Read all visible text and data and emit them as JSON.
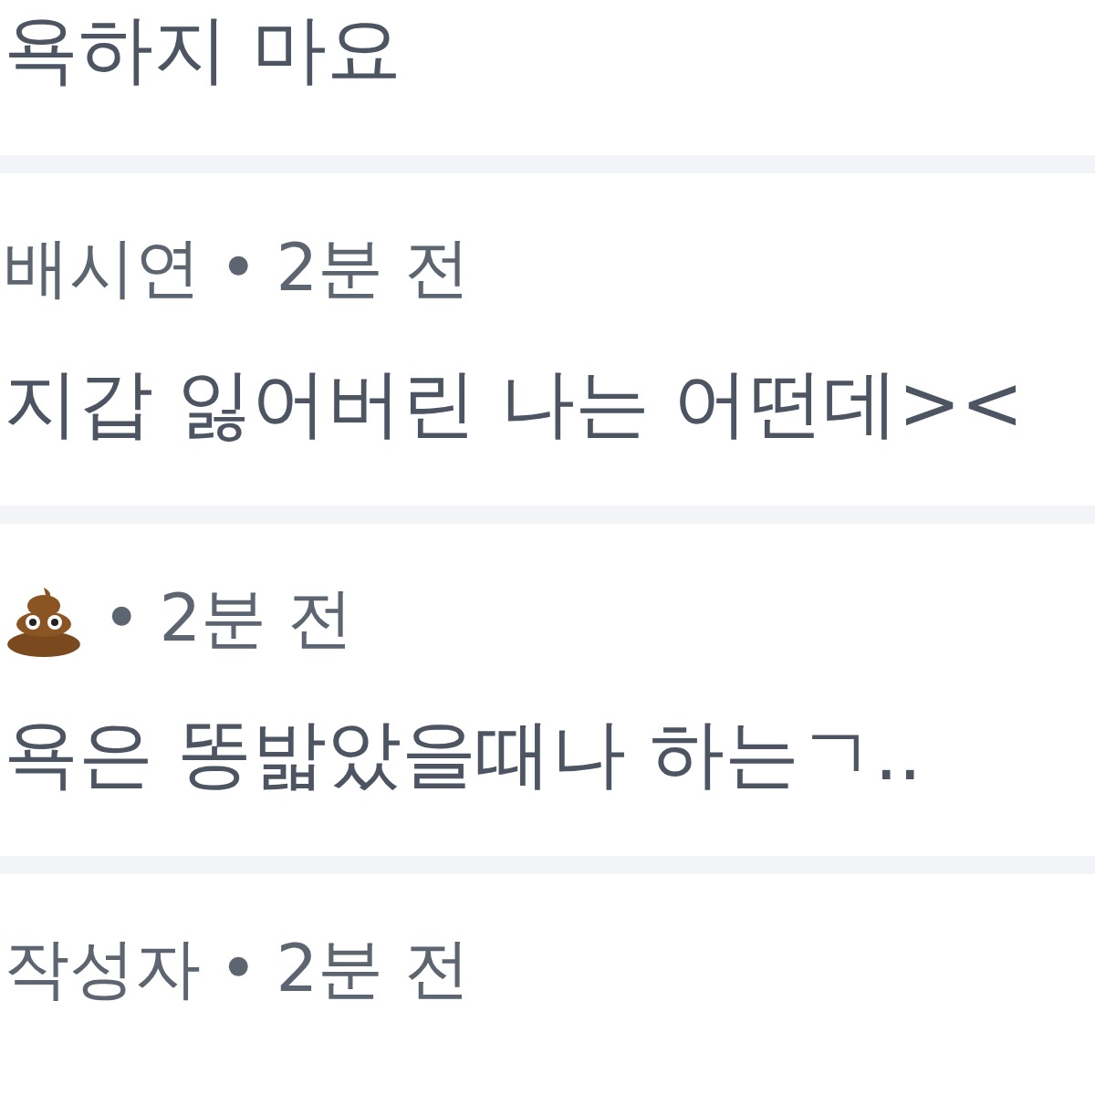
{
  "comments": [
    {
      "body": "욕하지 마요"
    },
    {
      "author": "배시연",
      "separator": "•",
      "time": "2분 전",
      "body": "지갑 잃어버린 나는 어떤데><"
    },
    {
      "separator": "•",
      "time": "2분 전",
      "body": "욕은 똥밟았을때나 하는ㄱ.."
    },
    {
      "author": "작성자",
      "separator": "•",
      "time": "2분 전"
    }
  ]
}
